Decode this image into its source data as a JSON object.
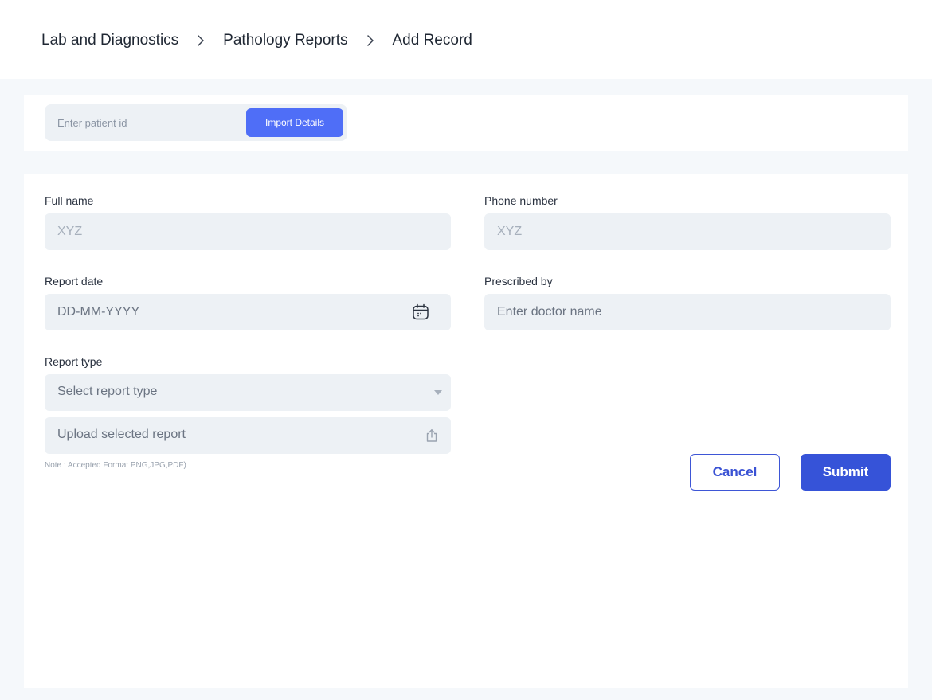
{
  "breadcrumb": {
    "items": [
      {
        "label": "Lab and Diagnostics"
      },
      {
        "label": "Pathology Reports"
      },
      {
        "label": "Add Record"
      }
    ],
    "separator_icon": "chevron-right-icon"
  },
  "import": {
    "patient_id_placeholder": "Enter patient id",
    "patient_id_value": "",
    "button_label": "Import Details",
    "button_color": "#4f6ef7"
  },
  "form": {
    "full_name": {
      "label": "Full name",
      "placeholder": "XYZ",
      "value": ""
    },
    "phone": {
      "label": "Phone number",
      "placeholder": "XYZ",
      "value": ""
    },
    "report_date": {
      "label": "Report date",
      "placeholder": "DD-MM-YYYY",
      "value": "",
      "icon": "calendar-icon"
    },
    "prescribed_by": {
      "label": "Prescribed by",
      "placeholder": "Enter doctor name",
      "value": ""
    },
    "report_type": {
      "label": "Report type",
      "selected": "Select report type",
      "icon": "caret-down-icon"
    },
    "upload": {
      "text": "Upload selected report",
      "icon": "upload-icon"
    },
    "note": "Note : Accepted Format PNG,JPG,PDF)"
  },
  "actions": {
    "cancel_label": "Cancel",
    "submit_label": "Submit",
    "primary_color": "#3653d8"
  }
}
